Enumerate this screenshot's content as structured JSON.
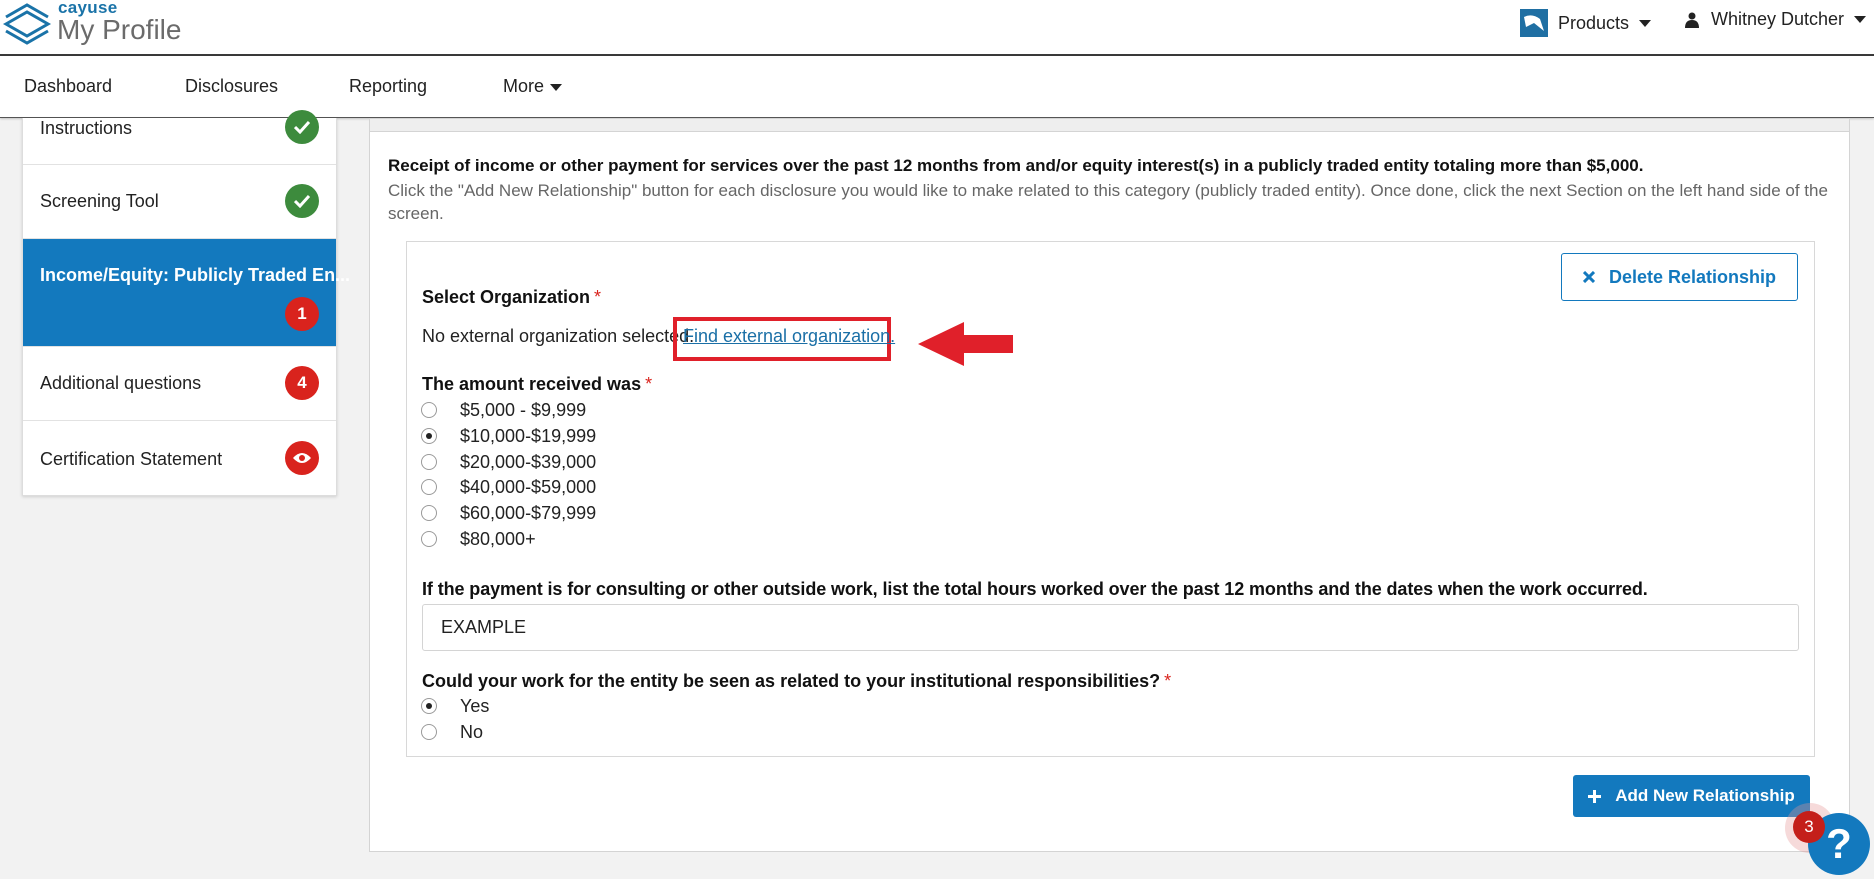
{
  "header": {
    "brand": "cayuse",
    "title": "My Profile",
    "products_label": "Products",
    "user_name": "Whitney Dutcher"
  },
  "nav": {
    "items": [
      "Dashboard",
      "Disclosures",
      "Reporting",
      "More"
    ]
  },
  "sidebar": {
    "items": [
      {
        "label": "Instructions",
        "badge": "check",
        "status": "complete"
      },
      {
        "label": "Screening Tool",
        "badge": "check",
        "status": "complete"
      },
      {
        "label": "Income/Equity: Publicly Traded En...",
        "badge": "1",
        "status": "active"
      },
      {
        "label": "Additional questions",
        "badge": "4",
        "status": "incomplete"
      },
      {
        "label": "Certification Statement",
        "badge": "eye-icon",
        "status": "incomplete"
      }
    ]
  },
  "main": {
    "intro_bold": "Receipt of income or other payment for services over the past 12 months from and/or equity interest(s) in a publicly traded entity totaling more than $5,000.",
    "intro_text": "Click the \"Add New Relationship\" button for each disclosure you would like to make related to this category (publicly traded entity).  Once done, click the next Section on the left hand side of the screen.",
    "delete_label": "Delete Relationship",
    "select_org_label": "Select Organization",
    "required_mark": "*",
    "no_org_text": "No external organization selected.",
    "find_org_link": "Find external organization.",
    "amount_label": "The amount received was",
    "amount_options": [
      "$5,000 - $9,999",
      "$10,000-$19,999",
      "$20,000-$39,000",
      "$40,000-$59,000",
      "$60,000-$79,999",
      "$80,000+"
    ],
    "amount_selected": "$10,000-$19,999",
    "consult_label": "If the payment is for consulting or other outside work, list the total hours worked over the past 12 months and the dates when the work occurred.",
    "consult_value": "EXAMPLE",
    "related_label": "Could your work for the entity be seen as related to your institutional responsibilities?",
    "related_options": [
      "Yes",
      "No"
    ],
    "related_selected": "Yes",
    "add_label": "Add New Relationship"
  },
  "help": {
    "symbol": "?",
    "badge_count": "3"
  },
  "colors": {
    "primary": "#1379be",
    "danger": "#d9231d",
    "success": "#3d8b3d",
    "annotation": "#e0202a"
  }
}
